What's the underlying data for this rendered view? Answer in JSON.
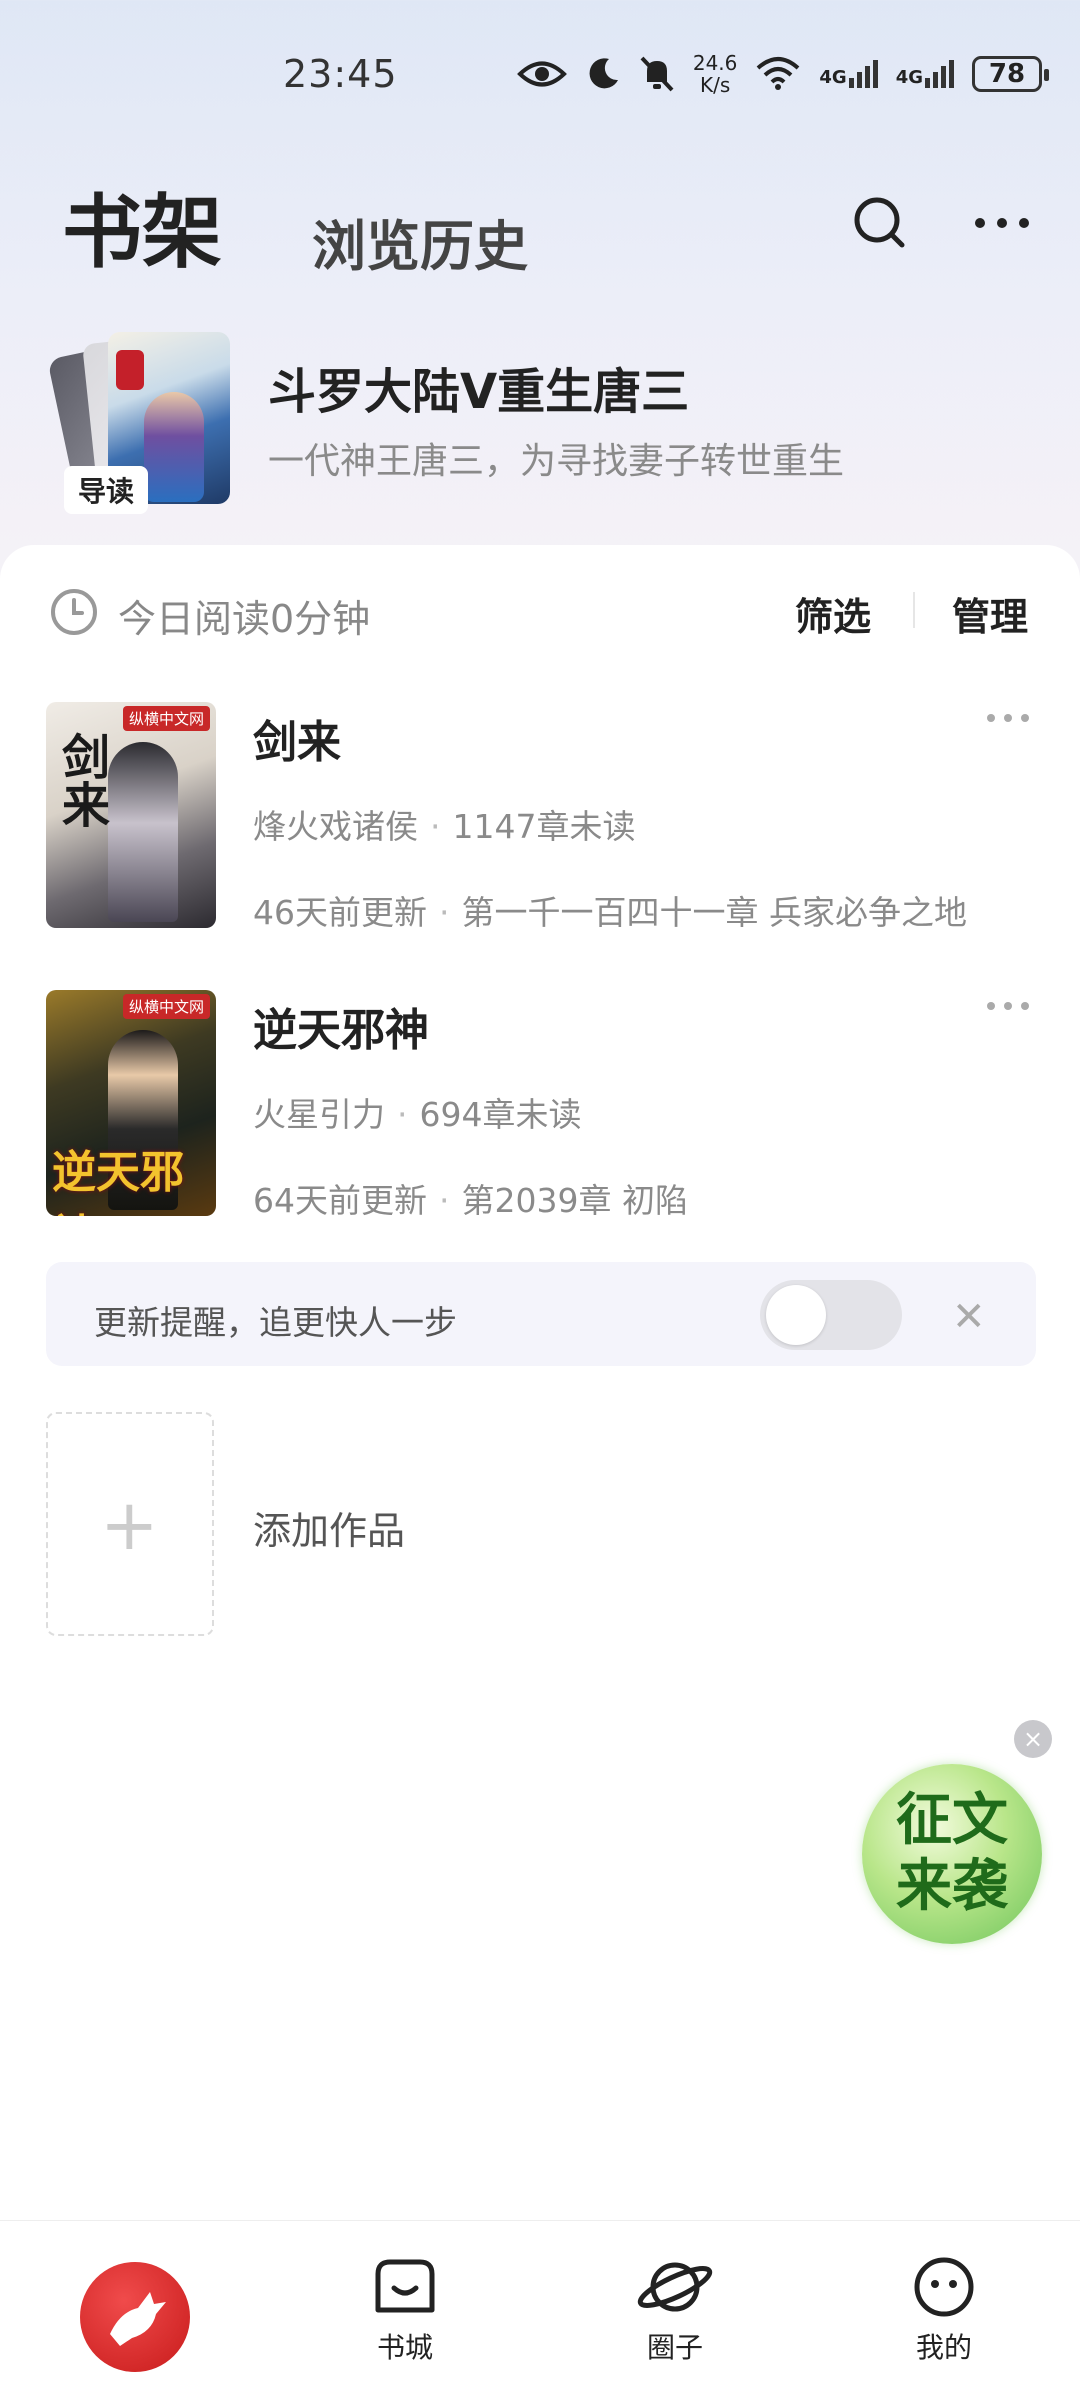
{
  "status_bar": {
    "time": "23:45",
    "speed_value": "24.6",
    "speed_unit": "K/s",
    "signal1": "4G",
    "signal2": "4G",
    "battery": "78"
  },
  "header": {
    "title": "书架",
    "tab_history": "浏览历史"
  },
  "recommended": {
    "badge": "导读",
    "title": "斗罗大陆V重生唐三",
    "description": "一代神王唐三，为寻找妻子转世重生"
  },
  "toolbar": {
    "reading_time": "今日阅读0分钟",
    "filter": "筛选",
    "manage": "管理"
  },
  "books": [
    {
      "title": "剑来",
      "author": "烽火戏诸侯",
      "unread": "1147章未读",
      "updated": "46天前更新",
      "latest_chapter": "第一千一百四十一章 兵家必争之地",
      "cover_text": "剑来",
      "cover_logo": "纵横中文网"
    },
    {
      "title": "逆天邪神",
      "author": "火星引力",
      "unread": "694章未读",
      "updated": "64天前更新",
      "latest_chapter": "第2039章 初陷",
      "cover_text": "逆天邪神",
      "cover_logo": "纵横中文网"
    }
  ],
  "reminder": {
    "text": "更新提醒，追更快人一步",
    "enabled": false
  },
  "add_book": {
    "label": "添加作品"
  },
  "floating_badge": {
    "text_line1": "征文",
    "text_line2": "来袭"
  },
  "bottom_nav": {
    "items": [
      {
        "label": "书城"
      },
      {
        "label": "圈子"
      },
      {
        "label": "我的"
      }
    ]
  },
  "colors": {
    "brand_red": "#d42a2a",
    "accent_green": "#6cc45a"
  }
}
